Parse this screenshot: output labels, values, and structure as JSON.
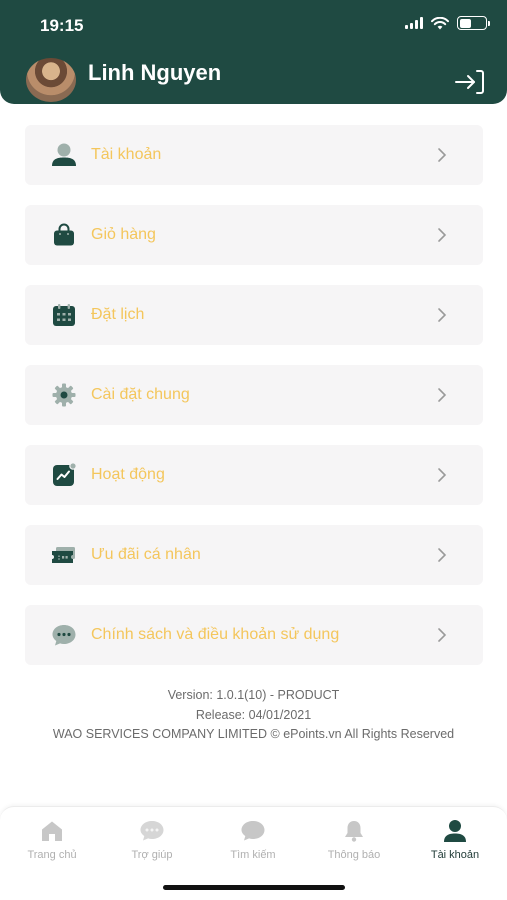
{
  "status_bar": {
    "time": "19:15"
  },
  "header": {
    "user_name": "Linh Nguyen"
  },
  "menu": {
    "items": [
      {
        "label": "Tài khoản",
        "icon": "user-icon"
      },
      {
        "label": "Giỏ hàng",
        "icon": "shopping-bag-icon"
      },
      {
        "label": "Đặt lịch",
        "icon": "calendar-icon"
      },
      {
        "label": "Cài đặt chung",
        "icon": "gear-icon"
      },
      {
        "label": "Hoạt động",
        "icon": "activity-chart-icon"
      },
      {
        "label": "Ưu đãi cá nhân",
        "icon": "voucher-icon"
      },
      {
        "label": "Chính sách và điều khoản sử dụng",
        "icon": "chat-bubble-icon"
      }
    ]
  },
  "footer": {
    "version": "Version: 1.0.1(10) - PRODUCT",
    "release": "Release: 04/01/2021",
    "copyright": "WAO SERVICES COMPANY LIMITED © ePoints.vn All Rights Reserved"
  },
  "tabbar": {
    "tabs": [
      {
        "label": "Trang chủ",
        "icon": "home-icon",
        "active": false
      },
      {
        "label": "Trợ giúp",
        "icon": "chat-bubble-icon",
        "active": false
      },
      {
        "label": "Tìm kiếm",
        "icon": "search-bubble-icon",
        "active": false
      },
      {
        "label": "Thông báo",
        "icon": "bell-icon",
        "active": false
      },
      {
        "label": "Tài khoản",
        "icon": "user-icon",
        "active": true
      }
    ]
  },
  "colors": {
    "header_bg": "#1f4a42",
    "accent_label": "#f4c65c",
    "icon_dark": "#1f4a42",
    "icon_muted": "#9fb0ab",
    "tab_inactive": "#c7c7c7"
  }
}
